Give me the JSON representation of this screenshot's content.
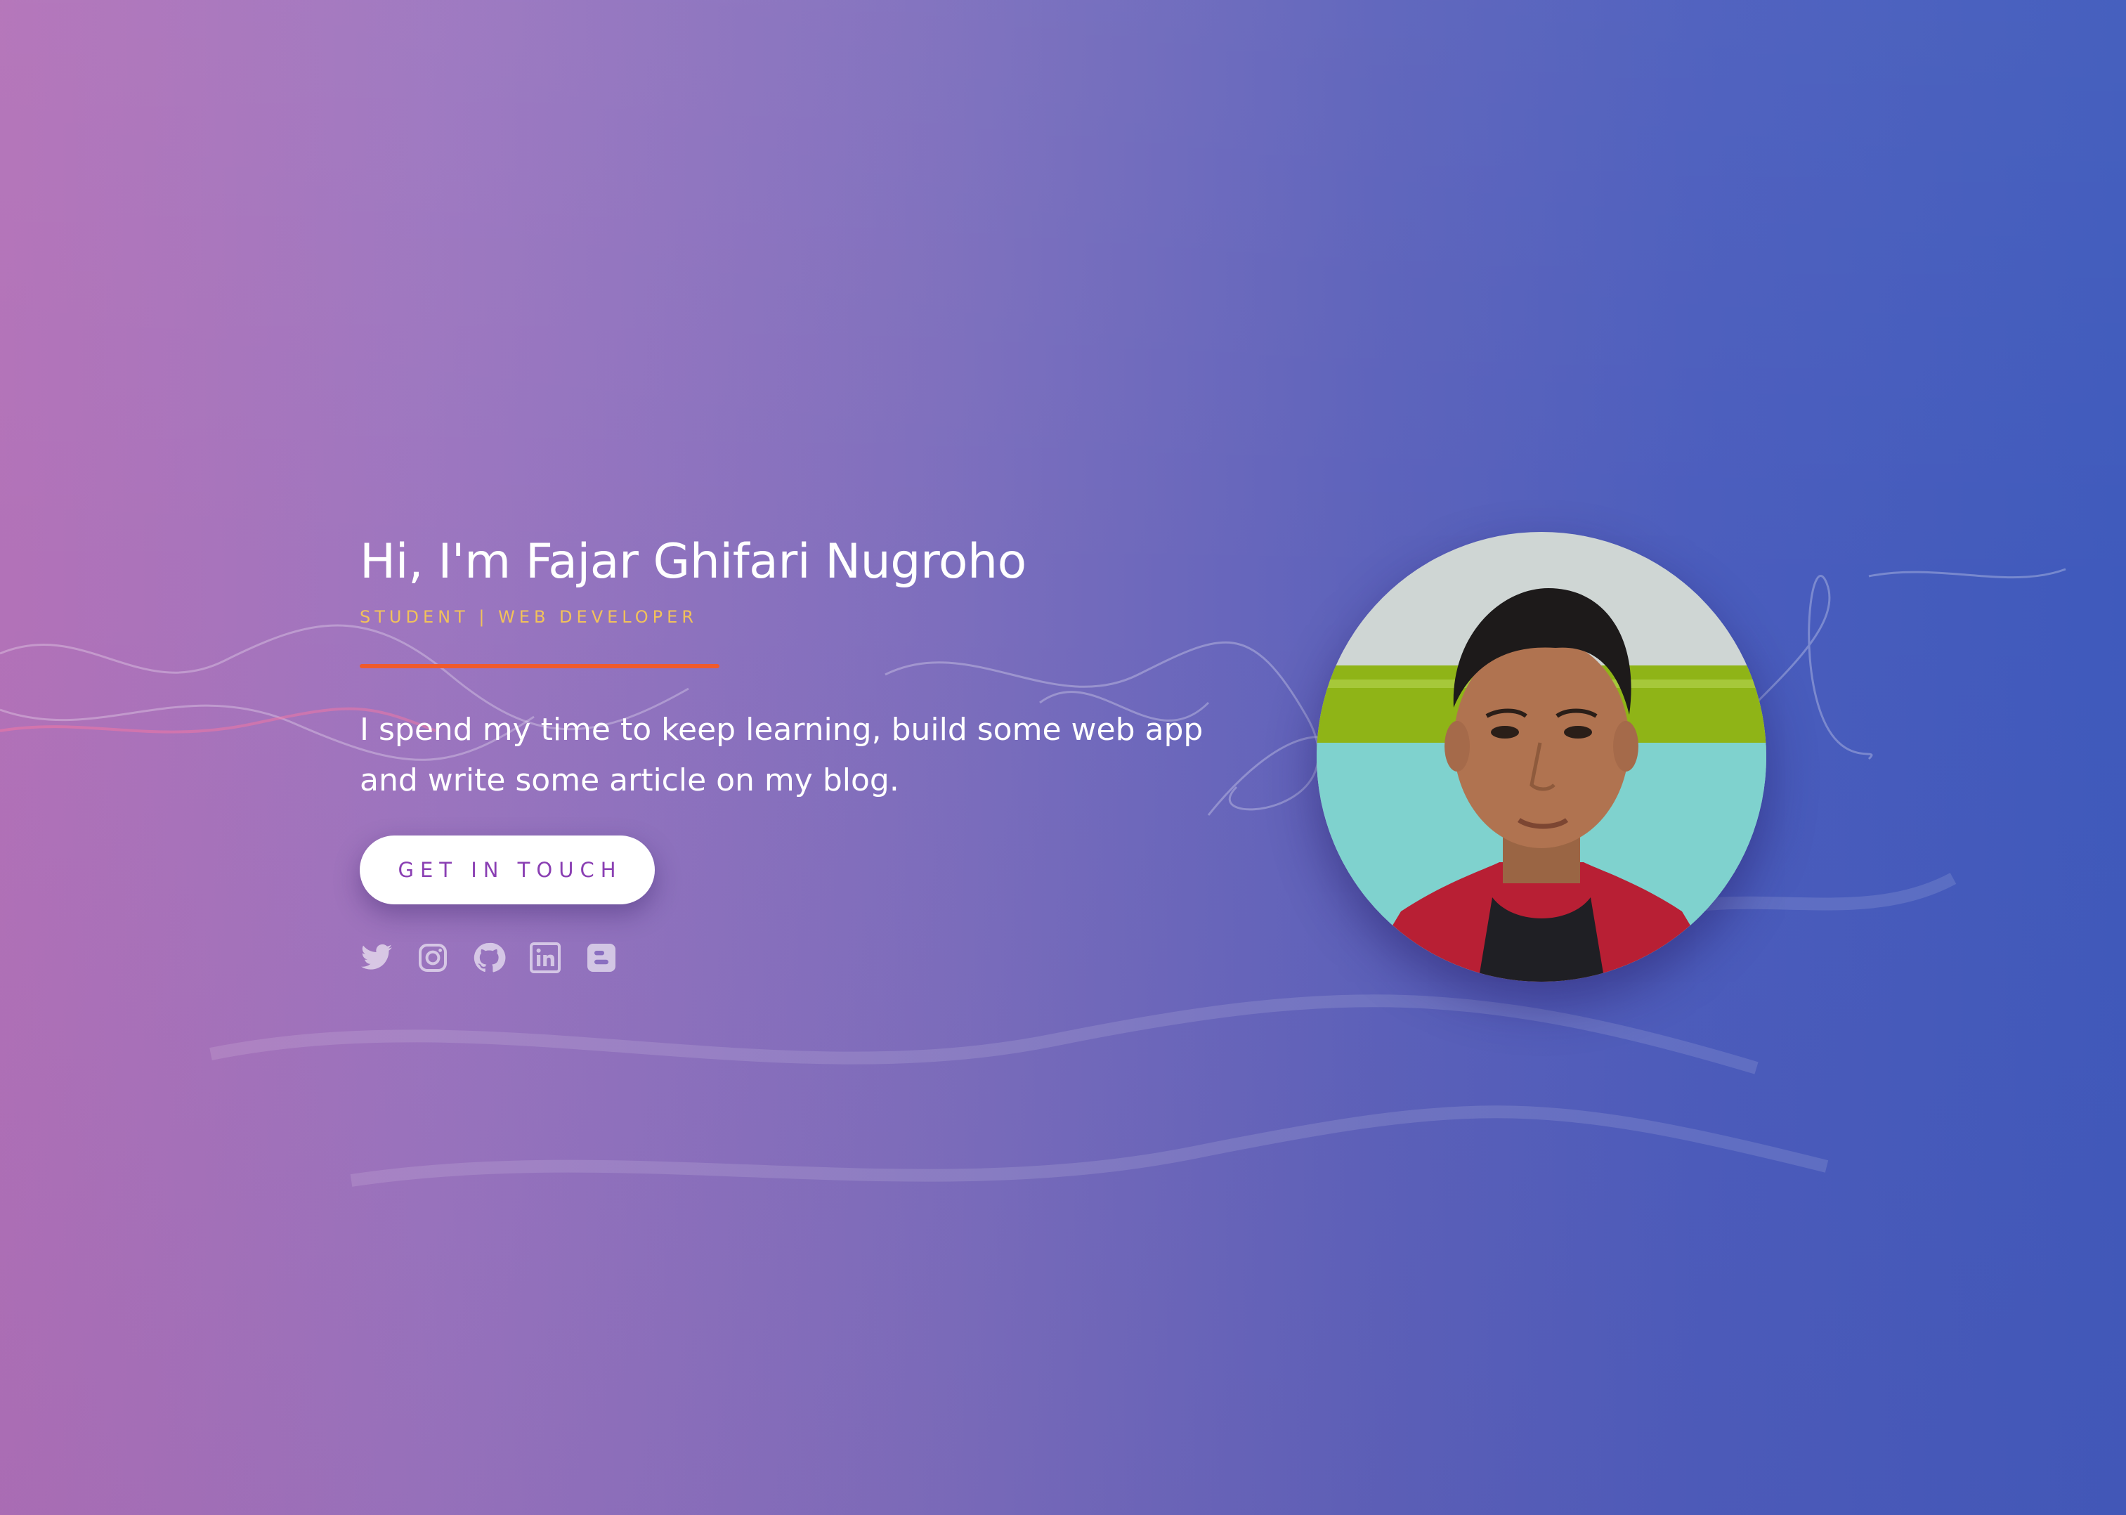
{
  "hero": {
    "title": "Hi, I'm Fajar Ghifari Nugroho",
    "subtitle": "STUDENT | WEB DEVELOPER",
    "description": "I spend my time to keep learning, build some web app and write some article on my blog.",
    "cta_label": "GET IN TOUCH"
  },
  "social": [
    {
      "icon": "twitter-icon"
    },
    {
      "icon": "instagram-icon"
    },
    {
      "icon": "github-icon"
    },
    {
      "icon": "linkedin-icon"
    },
    {
      "icon": "blogger-icon"
    }
  ],
  "avatar": {
    "icon": "profile-photo"
  },
  "colors": {
    "background_left": "#b277bb",
    "background_right": "#3f5abc",
    "accent_subtitle": "#f2c25a",
    "divider": "#f05a2c",
    "button_text": "#8a3fb3",
    "text": "#ffffff"
  }
}
